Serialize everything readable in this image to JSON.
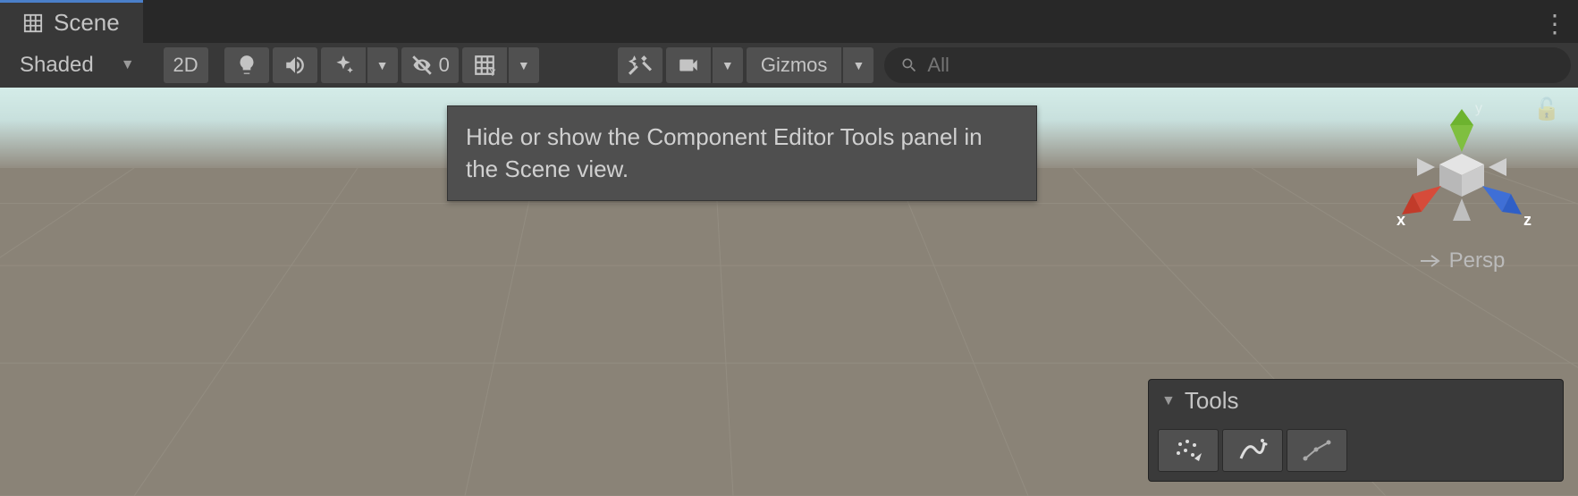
{
  "tab": {
    "label": "Scene"
  },
  "toolbar": {
    "drawmode": {
      "label": "Shaded"
    },
    "mode2d": {
      "label": "2D"
    },
    "hidden": {
      "count": "0"
    },
    "gizmos": {
      "label": "Gizmos"
    },
    "search": {
      "placeholder": "All"
    }
  },
  "tooltip": {
    "text": "Hide or show the Component Editor Tools panel in the Scene view."
  },
  "gizmo": {
    "axes": {
      "x": "x",
      "y": "y",
      "z": "z"
    },
    "projection": "Persp"
  },
  "tools_panel": {
    "title": "Tools"
  }
}
